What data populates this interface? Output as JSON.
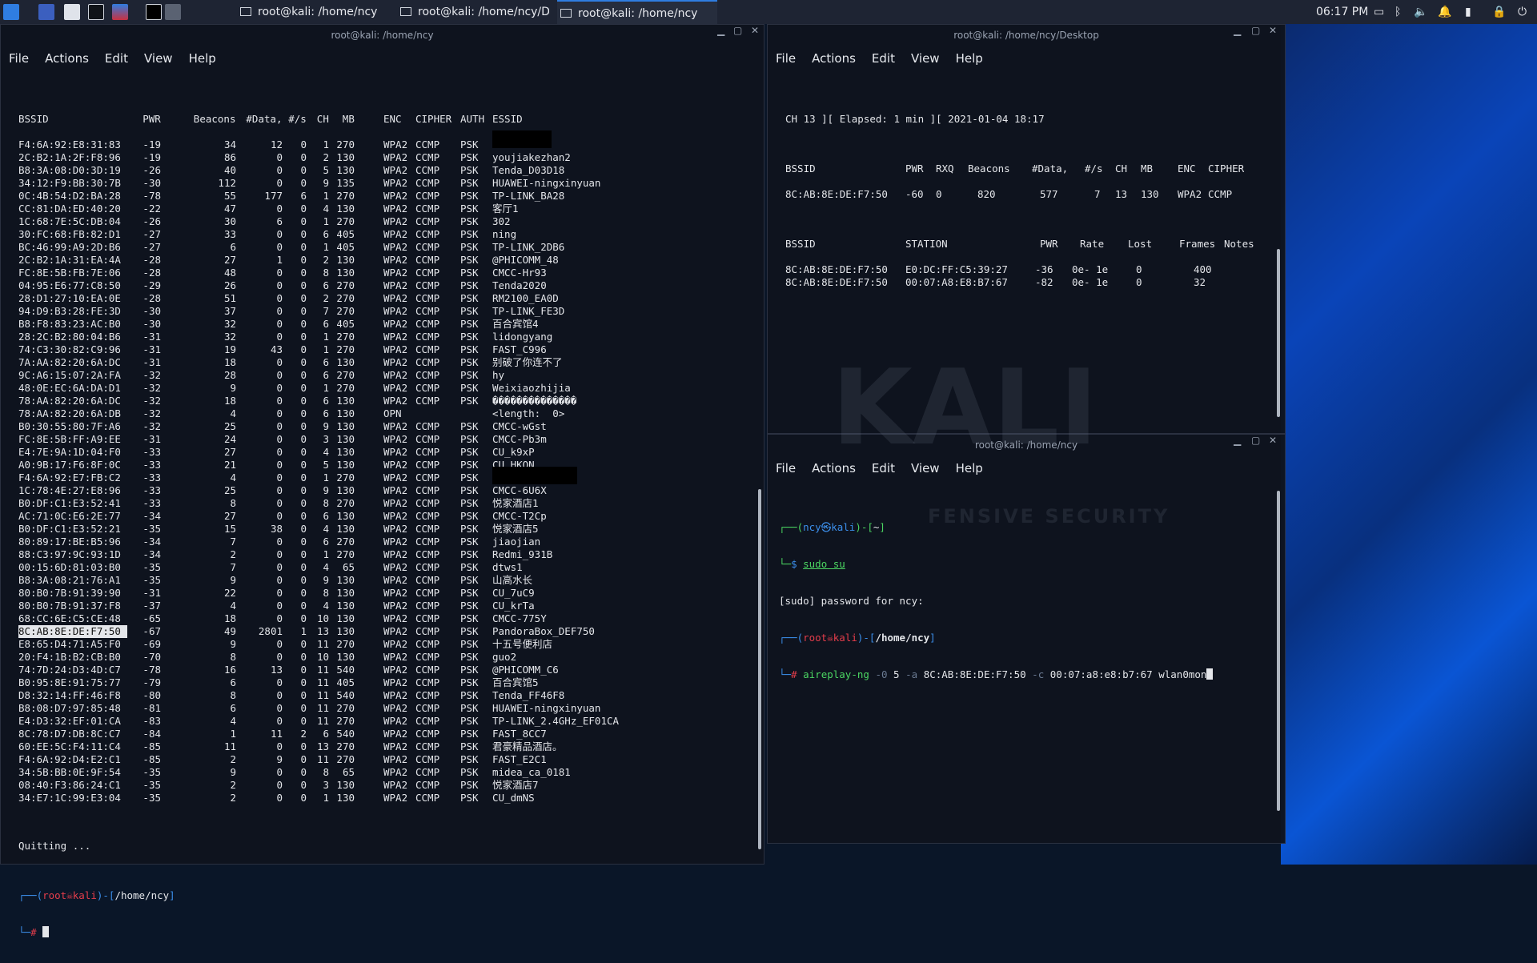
{
  "taskbar": {
    "tasks": [
      {
        "label": "root@kali: /home/ncy",
        "active": false
      },
      {
        "label": "root@kali: /home/ncy/D...",
        "active": false
      },
      {
        "label": "root@kali: /home/ncy",
        "active": true
      }
    ],
    "clock": "06:17 PM"
  },
  "menu": {
    "file": "File",
    "actions": "Actions",
    "edit": "Edit",
    "view": "View",
    "help": "Help"
  },
  "left": {
    "title": "root@kali: /home/ncy",
    "headers": [
      "BSSID",
      "PWR",
      "Beacons",
      "#Data,",
      "#/s",
      "CH",
      "MB",
      "ENC",
      "CIPHER",
      "AUTH",
      "ESSID"
    ],
    "rows": [
      [
        "F4:6A:92:E8:31:83",
        "-19",
        "34",
        "12",
        "0",
        "1",
        "270",
        "WPA2",
        "CCMP",
        "PSK",
        ""
      ],
      [
        "2C:B2:1A:2F:F8:96",
        "-19",
        "86",
        "0",
        "0",
        "2",
        "130",
        "WPA2",
        "CCMP",
        "PSK",
        "youjiakezhan2"
      ],
      [
        "B8:3A:08:D0:3D:19",
        "-26",
        "40",
        "0",
        "0",
        "5",
        "130",
        "WPA2",
        "CCMP",
        "PSK",
        "Tenda_D03D18"
      ],
      [
        "34:12:F9:BB:30:7B",
        "-30",
        "112",
        "0",
        "0",
        "9",
        "135",
        "WPA2",
        "CCMP",
        "PSK",
        "HUAWEI-ningxinyuan"
      ],
      [
        "0C:4B:54:D2:BA:28",
        "-78",
        "55",
        "177",
        "6",
        "1",
        "270",
        "WPA2",
        "CCMP",
        "PSK",
        "TP-LINK_BA28"
      ],
      [
        "CC:81:DA:ED:40:20",
        "-22",
        "47",
        "0",
        "0",
        "4",
        "130",
        "WPA2",
        "CCMP",
        "PSK",
        "客厅1"
      ],
      [
        "1C:68:7E:5C:DB:04",
        "-26",
        "30",
        "6",
        "0",
        "1",
        "270",
        "WPA2",
        "CCMP",
        "PSK",
        "302"
      ],
      [
        "30:FC:68:FB:82:D1",
        "-27",
        "33",
        "0",
        "0",
        "6",
        "405",
        "WPA2",
        "CCMP",
        "PSK",
        "ning"
      ],
      [
        "BC:46:99:A9:2D:B6",
        "-27",
        "6",
        "0",
        "0",
        "1",
        "405",
        "WPA2",
        "CCMP",
        "PSK",
        "TP-LINK_2DB6"
      ],
      [
        "2C:B2:1A:31:EA:4A",
        "-28",
        "27",
        "1",
        "0",
        "2",
        "130",
        "WPA2",
        "CCMP",
        "PSK",
        "@PHICOMM_48"
      ],
      [
        "FC:8E:5B:FB:7E:06",
        "-28",
        "48",
        "0",
        "0",
        "8",
        "130",
        "WPA2",
        "CCMP",
        "PSK",
        "CMCC-Hr93"
      ],
      [
        "04:95:E6:77:C8:50",
        "-29",
        "26",
        "0",
        "0",
        "6",
        "270",
        "WPA2",
        "CCMP",
        "PSK",
        "Tenda2020"
      ],
      [
        "28:D1:27:10:EA:0E",
        "-28",
        "51",
        "0",
        "0",
        "2",
        "270",
        "WPA2",
        "CCMP",
        "PSK",
        "RM2100_EA0D"
      ],
      [
        "94:D9:B3:28:FE:3D",
        "-30",
        "37",
        "0",
        "0",
        "7",
        "270",
        "WPA2",
        "CCMP",
        "PSK",
        "TP-LINK_FE3D"
      ],
      [
        "B8:F8:83:23:AC:B0",
        "-30",
        "32",
        "0",
        "0",
        "6",
        "405",
        "WPA2",
        "CCMP",
        "PSK",
        "百合宾馆4"
      ],
      [
        "28:2C:B2:80:04:B6",
        "-31",
        "32",
        "0",
        "0",
        "1",
        "270",
        "WPA2",
        "CCMP",
        "PSK",
        "lidongyang"
      ],
      [
        "74:C3:30:82:C9:96",
        "-31",
        "19",
        "43",
        "0",
        "1",
        "270",
        "WPA2",
        "CCMP",
        "PSK",
        "FAST_C996"
      ],
      [
        "7A:AA:82:20:6A:DC",
        "-31",
        "18",
        "0",
        "0",
        "6",
        "130",
        "WPA2",
        "CCMP",
        "PSK",
        "别破了你连不了"
      ],
      [
        "9C:A6:15:07:2A:FA",
        "-32",
        "28",
        "0",
        "0",
        "6",
        "270",
        "WPA2",
        "CCMP",
        "PSK",
        "hy"
      ],
      [
        "48:0E:EC:6A:DA:D1",
        "-32",
        "9",
        "0",
        "0",
        "1",
        "270",
        "WPA2",
        "CCMP",
        "PSK",
        "Weixiaozhijia"
      ],
      [
        "78:AA:82:20:6A:DC",
        "-32",
        "18",
        "0",
        "0",
        "6",
        "130",
        "WPA2",
        "CCMP",
        "PSK",
        "��������������"
      ],
      [
        "78:AA:82:20:6A:DB",
        "-32",
        "4",
        "0",
        "0",
        "6",
        "130",
        "OPN",
        "",
        "",
        "<length:  0>"
      ],
      [
        "B0:30:55:80:7F:A6",
        "-32",
        "25",
        "0",
        "0",
        "9",
        "130",
        "WPA2",
        "CCMP",
        "PSK",
        "CMCC-wGst"
      ],
      [
        "FC:8E:5B:FF:A9:EE",
        "-31",
        "24",
        "0",
        "0",
        "3",
        "130",
        "WPA2",
        "CCMP",
        "PSK",
        "CMCC-Pb3m"
      ],
      [
        "E4:7E:9A:1D:04:F0",
        "-33",
        "27",
        "0",
        "0",
        "4",
        "130",
        "WPA2",
        "CCMP",
        "PSK",
        "CU_k9xP"
      ],
      [
        "A0:9B:17:F6:8F:0C",
        "-33",
        "21",
        "0",
        "0",
        "5",
        "130",
        "WPA2",
        "CCMP",
        "PSK",
        "CU_HKQN"
      ],
      [
        "F4:6A:92:E7:FB:C2",
        "-33",
        "4",
        "0",
        "0",
        "1",
        "270",
        "WPA2",
        "CCMP",
        "PSK",
        ""
      ],
      [
        "1C:78:4E:27:E8:96",
        "-33",
        "25",
        "0",
        "0",
        "9",
        "130",
        "WPA2",
        "CCMP",
        "PSK",
        "CMCC-6U6X"
      ],
      [
        "B0:DF:C1:E3:52:41",
        "-33",
        "8",
        "0",
        "0",
        "8",
        "270",
        "WPA2",
        "CCMP",
        "PSK",
        "悦家酒店1"
      ],
      [
        "AC:71:0C:E6:2E:77",
        "-34",
        "27",
        "0",
        "0",
        "6",
        "130",
        "WPA2",
        "CCMP",
        "PSK",
        "CMCC-T2Cp"
      ],
      [
        "B0:DF:C1:E3:52:21",
        "-35",
        "15",
        "38",
        "0",
        "4",
        "130",
        "WPA2",
        "CCMP",
        "PSK",
        "悦家酒店5"
      ],
      [
        "80:89:17:BE:B5:96",
        "-34",
        "7",
        "0",
        "0",
        "6",
        "270",
        "WPA2",
        "CCMP",
        "PSK",
        "jiaojian"
      ],
      [
        "88:C3:97:9C:93:1D",
        "-34",
        "2",
        "0",
        "0",
        "1",
        "270",
        "WPA2",
        "CCMP",
        "PSK",
        "Redmi_931B"
      ],
      [
        "00:15:6D:81:03:B0",
        "-35",
        "7",
        "0",
        "0",
        "4",
        "65",
        "WPA2",
        "CCMP",
        "PSK",
        "dtws1"
      ],
      [
        "B8:3A:08:21:76:A1",
        "-35",
        "9",
        "0",
        "0",
        "9",
        "130",
        "WPA2",
        "CCMP",
        "PSK",
        "山高水长"
      ],
      [
        "80:B0:7B:91:39:90",
        "-31",
        "22",
        "0",
        "0",
        "8",
        "130",
        "WPA2",
        "CCMP",
        "PSK",
        "CU_7uC9"
      ],
      [
        "80:B0:7B:91:37:F8",
        "-37",
        "4",
        "0",
        "0",
        "4",
        "130",
        "WPA2",
        "CCMP",
        "PSK",
        "CU_krTa"
      ],
      [
        "68:CC:6E:C5:CE:48",
        "-65",
        "18",
        "0",
        "0",
        "10",
        "130",
        "WPA2",
        "CCMP",
        "PSK",
        "CMCC-775Y"
      ],
      [
        "8C:AB:8E:DE:F7:50",
        "-67",
        "49",
        "2801",
        "1",
        "13",
        "130",
        "WPA2",
        "CCMP",
        "PSK",
        "PandoraBox_DEF750"
      ],
      [
        "E8:65:D4:71:A5:F0",
        "-69",
        "9",
        "0",
        "0",
        "11",
        "270",
        "WPA2",
        "CCMP",
        "PSK",
        "十五号便利店"
      ],
      [
        "20:F4:1B:B2:CB:B0",
        "-70",
        "8",
        "0",
        "0",
        "10",
        "130",
        "WPA2",
        "CCMP",
        "PSK",
        "guo2"
      ],
      [
        "74:7D:24:D3:4D:C7",
        "-78",
        "16",
        "13",
        "0",
        "11",
        "540",
        "WPA2",
        "CCMP",
        "PSK",
        "@PHICOMM_C6"
      ],
      [
        "B0:95:8E:91:75:77",
        "-79",
        "6",
        "0",
        "0",
        "11",
        "405",
        "WPA2",
        "CCMP",
        "PSK",
        "百合宾馆5"
      ],
      [
        "D8:32:14:FF:46:F8",
        "-80",
        "8",
        "0",
        "0",
        "11",
        "540",
        "WPA2",
        "CCMP",
        "PSK",
        "Tenda_FF46F8"
      ],
      [
        "B8:08:D7:97:85:48",
        "-81",
        "6",
        "0",
        "0",
        "11",
        "270",
        "WPA2",
        "CCMP",
        "PSK",
        "HUAWEI-ningxinyuan"
      ],
      [
        "E4:D3:32:EF:01:CA",
        "-83",
        "4",
        "0",
        "0",
        "11",
        "270",
        "WPA2",
        "CCMP",
        "PSK",
        "TP-LINK_2.4GHz_EF01CA"
      ],
      [
        "8C:78:D7:DB:8C:C7",
        "-84",
        "1",
        "11",
        "2",
        "6",
        "540",
        "WPA2",
        "CCMP",
        "PSK",
        "FAST_8CC7"
      ],
      [
        "60:EE:5C:F4:11:C4",
        "-85",
        "11",
        "0",
        "0",
        "13",
        "270",
        "WPA2",
        "CCMP",
        "PSK",
        "君豪精品酒店。"
      ],
      [
        "F4:6A:92:D4:E2:C1",
        "-85",
        "2",
        "9",
        "0",
        "11",
        "270",
        "WPA2",
        "CCMP",
        "PSK",
        "FAST_E2C1"
      ],
      [
        "34:5B:BB:0E:9F:54",
        "-35",
        "9",
        "0",
        "0",
        "8",
        "65",
        "WPA2",
        "CCMP",
        "PSK",
        "midea_ca_0181"
      ],
      [
        "08:40:F3:86:24:C1",
        "-35",
        "2",
        "0",
        "0",
        "3",
        "130",
        "WPA2",
        "CCMP",
        "PSK",
        "悦家酒店7"
      ],
      [
        "34:E7:1C:99:E3:04",
        "-35",
        "2",
        "0",
        "0",
        "1",
        "130",
        "WPA2",
        "CCMP",
        "PSK",
        "CU_dmNS"
      ]
    ],
    "quitting": "Quitting ...",
    "prompt": {
      "user": "root",
      "host": "kali",
      "path": "/home/ncy",
      "hash": "#"
    }
  },
  "topright": {
    "title": "root@kali: /home/ncy/Desktop",
    "status": "CH 13 ][ Elapsed: 1 min ][ 2021-01-04 18:17",
    "ap_headers": [
      "BSSID",
      "PWR",
      "RXQ",
      "Beacons",
      "#Data,",
      "#/s",
      "CH",
      "MB",
      "ENC",
      "CIPHER"
    ],
    "ap_row": [
      "8C:AB:8E:DE:F7:50",
      "-60",
      "0",
      "820",
      "577",
      "7",
      "13",
      "130",
      "WPA2",
      "CCMP"
    ],
    "st_headers": [
      "BSSID",
      "STATION",
      "PWR",
      "Rate",
      "Lost",
      "Frames",
      "Notes"
    ],
    "st_rows": [
      [
        "8C:AB:8E:DE:F7:50",
        "E0:DC:FF:C5:39:27",
        "-36",
        "0e- 1e",
        "0",
        "400",
        ""
      ],
      [
        "8C:AB:8E:DE:F7:50",
        "00:07:A8:E8:B7:67",
        "-82",
        "0e- 1e",
        "0",
        "32",
        ""
      ]
    ]
  },
  "bottomright": {
    "title": "root@kali: /home/ncy",
    "line1_user": "ncy",
    "line1_host": "kali",
    "line1_path": "~",
    "cmd1_sym": "$",
    "cmd1": "sudo su",
    "sudo_prompt": "[sudo] password for ncy:",
    "line3_user": "root",
    "line3_host": "kali",
    "line3_path": "/home/ncy",
    "cmd2_sym": "#",
    "cmd2_prog": "aireplay-ng",
    "cmd2_args": [
      {
        "t": "flag",
        "v": "-0"
      },
      {
        "t": "val",
        "v": "5"
      },
      {
        "t": "flag",
        "v": "-a"
      },
      {
        "t": "val",
        "v": "8C:AB:8E:DE:F7:50"
      },
      {
        "t": "flag",
        "v": "-c"
      },
      {
        "t": "val",
        "v": "00:07:a8:e8:b7:67"
      },
      {
        "t": "val",
        "v": "wlan0mon"
      }
    ],
    "watermark_big": "KALI",
    "watermark_small": "FENSIVE SECURITY"
  },
  "colors": {
    "prompt_blue": "#3b8eea",
    "prompt_red": "#e43d4b",
    "flag": "#6a7a92",
    "accent": "#2f7de1"
  }
}
